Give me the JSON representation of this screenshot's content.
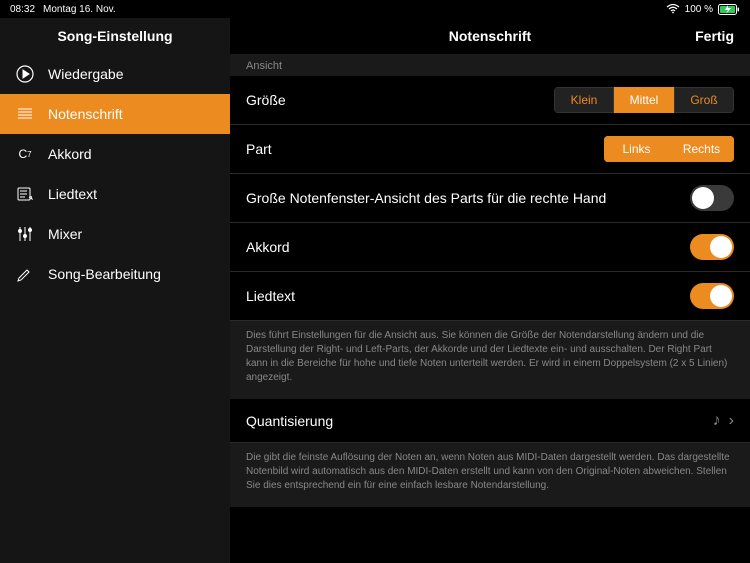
{
  "status": {
    "time": "08:32",
    "date": "Montag 16. Nov.",
    "battery": "100 %"
  },
  "sidebar": {
    "title": "Song-Einstellung",
    "items": [
      {
        "label": "Wiedergabe"
      },
      {
        "label": "Notenschrift"
      },
      {
        "label": "Akkord"
      },
      {
        "label": "Liedtext"
      },
      {
        "label": "Mixer"
      },
      {
        "label": "Song-Bearbeitung"
      }
    ]
  },
  "header": {
    "title": "Notenschrift",
    "done": "Fertig"
  },
  "view_section": {
    "label": "Ansicht",
    "size_label": "Größe",
    "size_options": {
      "small": "Klein",
      "medium": "Mittel",
      "large": "Groß"
    },
    "part_label": "Part",
    "part_options": {
      "left": "Links",
      "right": "Rechts"
    },
    "big_right_label": "Große Notenfenster-Ansicht des Parts für die rechte Hand",
    "chord_label": "Akkord",
    "lyric_label": "Liedtext",
    "help": "Dies führt Einstellungen für die Ansicht aus. Sie können die Größe der Notendarstellung ändern und die Darstellung der Right- und Left-Parts, der Akkorde und der Liedtexte ein- und ausschalten. Der Right Part kann in die Bereiche für hohe und tiefe Noten unterteilt werden. Er wird in einem Doppelsystem (2 x 5 Linien) angezeigt."
  },
  "quant_section": {
    "label": "Quantisierung",
    "help": "Die gibt die feinste Auflösung der Noten an, wenn Noten aus MIDI-Daten dargestellt werden. Das dargestellte Notenbild wird automatisch aus den MIDI-Daten erstellt und kann von den Original-Noten abweichen. Stellen Sie dies entsprechend ein für eine einfach lesbare Notendarstellung."
  }
}
